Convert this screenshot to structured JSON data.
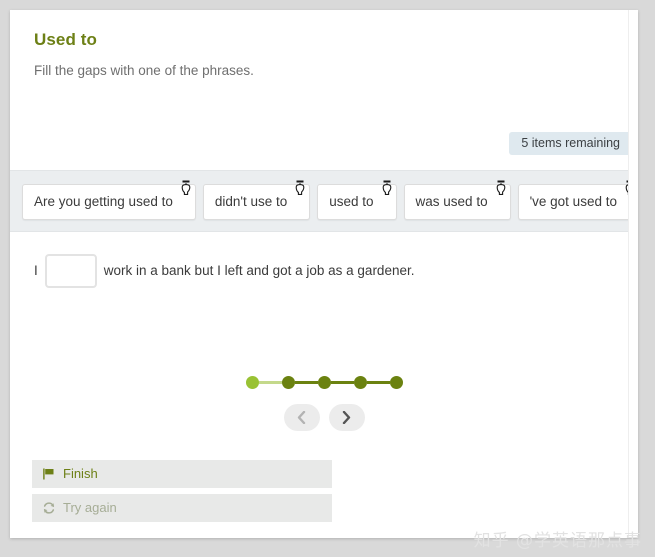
{
  "colors": {
    "page_background": "#d9d9d9",
    "card_background": "#ffffff",
    "title_green": "#6d8016",
    "badge_background": "#dfe9ef",
    "chip_band_background": "#ebeef0",
    "dot_current": "#99c234",
    "dot_done": "#6b8210",
    "action_background": "#e8e9e8",
    "finish_text": "#6d8016",
    "try_again_text": "#a6ad96"
  },
  "header": {
    "title": "Used to",
    "instructions": "Fill the gaps with one of the phrases."
  },
  "status": {
    "items_remaining": "5 items remaining"
  },
  "chips": [
    {
      "label": "Are you getting used to",
      "icon": "grab-hand-icon"
    },
    {
      "label": "didn't use to",
      "icon": "grab-hand-icon"
    },
    {
      "label": "used to",
      "icon": "grab-hand-icon"
    },
    {
      "label": "was used to",
      "icon": "grab-hand-icon"
    },
    {
      "label": "'ve got used to",
      "icon": "grab-hand-icon"
    }
  ],
  "sentence": {
    "before_gap": "I",
    "gap_value": "",
    "gap_placeholder": "",
    "after_gap": "work in a bank but I left and got a job as a gardener."
  },
  "progress": {
    "total": 5,
    "current_index": 1,
    "dots": [
      {
        "state": "current"
      },
      {
        "state": "done"
      },
      {
        "state": "done"
      },
      {
        "state": "done"
      },
      {
        "state": "done"
      }
    ]
  },
  "navigation": {
    "previous_label": "‹",
    "previous_icon": "chevron-left-icon",
    "next_label": "›",
    "next_icon": "chevron-right-icon"
  },
  "actions": [
    {
      "label": "Finish",
      "icon": "flag-icon"
    },
    {
      "label": "Try again",
      "icon": "refresh-icon"
    }
  ],
  "watermark": {
    "text": "知乎 @学英语那点事"
  }
}
